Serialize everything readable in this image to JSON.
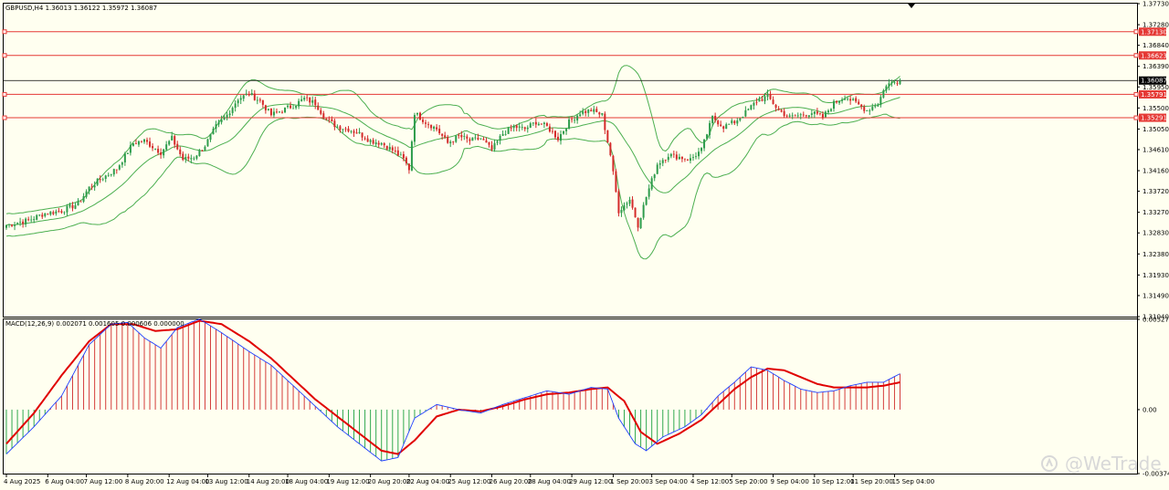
{
  "header": {
    "symbol_info": "GBPUSD,H4  1.36013 1.36122 1.35972 1.36087",
    "macd_info": "MACD(12,26,9) 0.002071 0.001605 0.000606 0.000000"
  },
  "watermark": "@WeTrade",
  "colors": {
    "background": "#fffff0",
    "bull": "#2e9c4c",
    "bear": "#d42a2a",
    "bands": "#4caf50",
    "level": "#e53935",
    "current": "#000000",
    "macd_line": "#1f3fff",
    "signal_line": "#e00000",
    "hist_pos": "#d43b3b",
    "hist_neg": "#2fa84f"
  },
  "chart_data": [
    {
      "type": "candlestick",
      "title": "GBPUSD,H4",
      "ylim": [
        1.3104,
        1.3773
      ],
      "y_ticks": [
        "1.37730",
        "1.37280",
        "1.36840",
        "1.36390",
        "1.35950",
        "1.35500",
        "1.35050",
        "1.34610",
        "1.34160",
        "1.33720",
        "1.33270",
        "1.32830",
        "1.32380",
        "1.31930",
        "1.31490",
        "1.31040"
      ],
      "x_ticks": [
        "4 Aug 2025",
        "6 Aug 04:00",
        "7 Aug 12:00",
        "8 Aug 20:00",
        "12 Aug 04:00",
        "13 Aug 12:00",
        "14 Aug 20:00",
        "18 Aug 04:00",
        "19 Aug 12:00",
        "20 Aug 20:00",
        "22 Aug 04:00",
        "25 Aug 12:00",
        "26 Aug 20:00",
        "28 Aug 04:00",
        "29 Aug 12:00",
        "1 Sep 20:00",
        "3 Sep 04:00",
        "4 Sep 12:00",
        "5 Sep 20:00",
        "9 Sep 04:00",
        "10 Sep 12:00",
        "11 Sep 20:00",
        "15 Sep 04:00"
      ],
      "current_price": "1.36087",
      "levels": [
        {
          "price": 1.3713,
          "label": "1.37130"
        },
        {
          "price": 1.36623,
          "label": "1.36623"
        },
        {
          "price": 1.35791,
          "label": "1.35791"
        },
        {
          "price": 1.35291,
          "label": "1.35291"
        }
      ],
      "close_path": [
        [
          0,
          1.33
        ],
        [
          8,
          1.331
        ],
        [
          14,
          1.3325
        ],
        [
          20,
          1.333
        ],
        [
          26,
          1.3345
        ],
        [
          30,
          1.338
        ],
        [
          36,
          1.3405
        ],
        [
          40,
          1.342
        ],
        [
          46,
          1.3475
        ],
        [
          50,
          1.348
        ],
        [
          56,
          1.3455
        ],
        [
          60,
          1.3485
        ],
        [
          64,
          1.344
        ],
        [
          68,
          1.3445
        ],
        [
          72,
          1.347
        ],
        [
          76,
          1.351
        ],
        [
          80,
          1.3535
        ],
        [
          84,
          1.357
        ],
        [
          88,
          1.358
        ],
        [
          92,
          1.3565
        ],
        [
          96,
          1.3535
        ],
        [
          100,
          1.3545
        ],
        [
          104,
          1.3555
        ],
        [
          108,
          1.357
        ],
        [
          112,
          1.356
        ],
        [
          116,
          1.3525
        ],
        [
          120,
          1.351
        ],
        [
          124,
          1.3505
        ],
        [
          128,
          1.3495
        ],
        [
          132,
          1.348
        ],
        [
          136,
          1.3475
        ],
        [
          140,
          1.346
        ],
        [
          144,
          1.344
        ],
        [
          146,
          1.342
        ],
        [
          148,
          1.354
        ],
        [
          152,
          1.352
        ],
        [
          156,
          1.3505
        ],
        [
          160,
          1.3475
        ],
        [
          164,
          1.349
        ],
        [
          168,
          1.348
        ],
        [
          172,
          1.3485
        ],
        [
          176,
          1.346
        ],
        [
          180,
          1.3495
        ],
        [
          184,
          1.351
        ],
        [
          188,
          1.3505
        ],
        [
          192,
          1.352
        ],
        [
          196,
          1.351
        ],
        [
          200,
          1.3485
        ],
        [
          204,
          1.352
        ],
        [
          208,
          1.354
        ],
        [
          212,
          1.3545
        ],
        [
          216,
          1.3535
        ],
        [
          219,
          1.345
        ],
        [
          222,
          1.333
        ],
        [
          226,
          1.3355
        ],
        [
          229,
          1.33
        ],
        [
          232,
          1.336
        ],
        [
          236,
          1.343
        ],
        [
          240,
          1.345
        ],
        [
          244,
          1.3445
        ],
        [
          248,
          1.344
        ],
        [
          252,
          1.346
        ],
        [
          256,
          1.353
        ],
        [
          260,
          1.351
        ],
        [
          264,
          1.352
        ],
        [
          268,
          1.354
        ],
        [
          272,
          1.3565
        ],
        [
          276,
          1.3575
        ],
        [
          280,
          1.3545
        ],
        [
          284,
          1.353
        ],
        [
          288,
          1.3535
        ],
        [
          292,
          1.354
        ],
        [
          296,
          1.353
        ],
        [
          300,
          1.356
        ],
        [
          304,
          1.3575
        ],
        [
          308,
          1.356
        ],
        [
          312,
          1.3545
        ],
        [
          316,
          1.356
        ],
        [
          319,
          1.36
        ],
        [
          322,
          1.3605
        ],
        [
          324,
          1.36087
        ]
      ]
    },
    {
      "type": "macd",
      "title": "MACD(12,26,9)",
      "ylim": [
        -0.00374,
        0.005279
      ],
      "y_ticks": [
        "0.005279",
        "0.00",
        "-0.00374"
      ],
      "macd_path": [
        [
          0,
          -0.0026
        ],
        [
          10,
          -0.001
        ],
        [
          20,
          0.0008
        ],
        [
          30,
          0.0038
        ],
        [
          38,
          0.005
        ],
        [
          44,
          0.0051
        ],
        [
          50,
          0.0042
        ],
        [
          56,
          0.0036
        ],
        [
          62,
          0.0048
        ],
        [
          70,
          0.0053
        ],
        [
          78,
          0.0045
        ],
        [
          88,
          0.0034
        ],
        [
          96,
          0.0026
        ],
        [
          104,
          0.0014
        ],
        [
          112,
          0.0002
        ],
        [
          120,
          -0.001
        ],
        [
          128,
          -0.002
        ],
        [
          136,
          -0.003
        ],
        [
          142,
          -0.0028
        ],
        [
          148,
          -0.0005
        ],
        [
          156,
          0.0003
        ],
        [
          164,
          0.0
        ],
        [
          172,
          -0.0002
        ],
        [
          180,
          0.0003
        ],
        [
          188,
          0.0007
        ],
        [
          196,
          0.0011
        ],
        [
          204,
          0.0009
        ],
        [
          212,
          0.0013
        ],
        [
          218,
          0.0012
        ],
        [
          222,
          -0.0005
        ],
        [
          228,
          -0.002
        ],
        [
          232,
          -0.0024
        ],
        [
          238,
          -0.0016
        ],
        [
          246,
          -0.001
        ],
        [
          252,
          -0.0003
        ],
        [
          258,
          0.0008
        ],
        [
          264,
          0.0016
        ],
        [
          270,
          0.0025
        ],
        [
          276,
          0.0023
        ],
        [
          282,
          0.0017
        ],
        [
          288,
          0.0012
        ],
        [
          294,
          0.001
        ],
        [
          300,
          0.0011
        ],
        [
          306,
          0.0014
        ],
        [
          312,
          0.0016
        ],
        [
          318,
          0.0016
        ],
        [
          324,
          0.0021
        ]
      ],
      "signal_path": [
        [
          0,
          -0.002
        ],
        [
          10,
          -0.0002
        ],
        [
          20,
          0.002
        ],
        [
          30,
          0.004
        ],
        [
          38,
          0.005
        ],
        [
          46,
          0.005
        ],
        [
          54,
          0.0046
        ],
        [
          62,
          0.0047
        ],
        [
          70,
          0.0052
        ],
        [
          78,
          0.005
        ],
        [
          88,
          0.004
        ],
        [
          96,
          0.003
        ],
        [
          104,
          0.0018
        ],
        [
          112,
          0.0006
        ],
        [
          120,
          -0.0004
        ],
        [
          128,
          -0.0014
        ],
        [
          136,
          -0.0024
        ],
        [
          142,
          -0.0026
        ],
        [
          148,
          -0.0018
        ],
        [
          156,
          -0.0004
        ],
        [
          164,
          0.0
        ],
        [
          172,
          -0.0001
        ],
        [
          180,
          0.0002
        ],
        [
          188,
          0.0006
        ],
        [
          196,
          0.0009
        ],
        [
          204,
          0.001
        ],
        [
          212,
          0.0012
        ],
        [
          218,
          0.0013
        ],
        [
          224,
          0.0005
        ],
        [
          230,
          -0.0013
        ],
        [
          236,
          -0.002
        ],
        [
          244,
          -0.0014
        ],
        [
          252,
          -0.0006
        ],
        [
          258,
          0.0003
        ],
        [
          264,
          0.0012
        ],
        [
          270,
          0.0019
        ],
        [
          276,
          0.0024
        ],
        [
          282,
          0.0023
        ],
        [
          288,
          0.0019
        ],
        [
          294,
          0.0015
        ],
        [
          300,
          0.0013
        ],
        [
          306,
          0.0013
        ],
        [
          312,
          0.0013
        ],
        [
          318,
          0.0014
        ],
        [
          324,
          0.0016
        ]
      ]
    }
  ]
}
